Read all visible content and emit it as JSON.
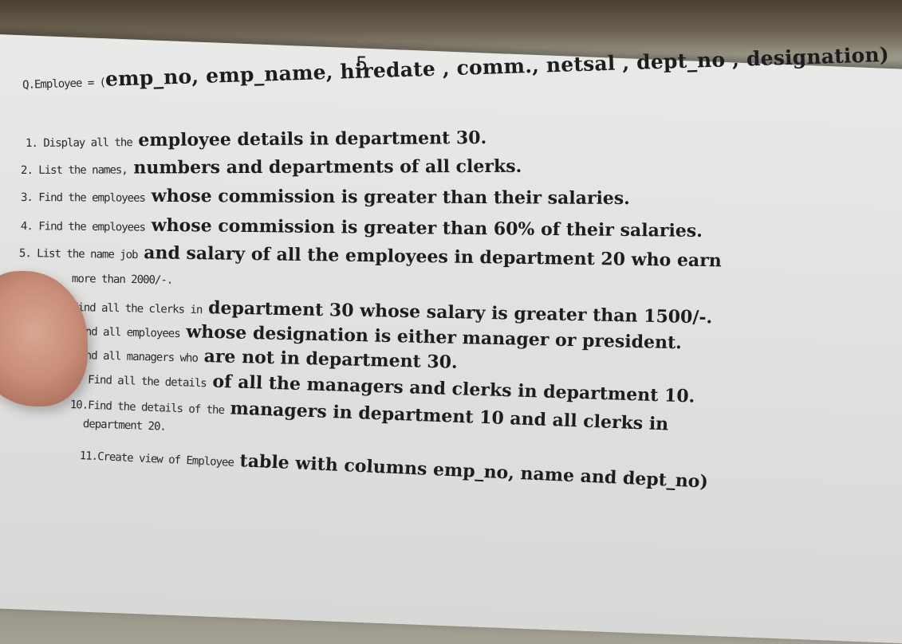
{
  "page_number": "5",
  "header": {
    "prefix": "Q.Employee = (",
    "text": "emp_no, emp_name, hiredate , comm., netsal , dept_no , designation)"
  },
  "questions": [
    {
      "prefix": "1. Display all the",
      "text": "employee details in department 30."
    },
    {
      "prefix": "2. List the names,",
      "text": "numbers and departments of all clerks."
    },
    {
      "prefix": "3. Find the employees",
      "text": "whose commission is greater than their salaries."
    },
    {
      "prefix": "4. Find the employees",
      "text": "whose commission is greater than 60% of their salaries."
    },
    {
      "prefix": "5. List the name job",
      "text": "and salary of all the employees in department 20 who earn"
    },
    {
      "prefix": "more than 2000/-.",
      "text": ""
    },
    {
      "prefix": "Find all the clerks in",
      "text": "department 30 whose salary is greater than 1500/-."
    },
    {
      "prefix": "Find all employees",
      "text": "whose designation is either manager or president."
    },
    {
      "prefix": "Find all managers who",
      "text": "are not in department 30."
    },
    {
      "prefix": "9. Find all the details",
      "text": "of all the managers and clerks in department 10."
    },
    {
      "prefix": "10.Find the details of the",
      "text": "managers in department 10 and all clerks in"
    },
    {
      "prefix": "department 20.",
      "text": ""
    },
    {
      "prefix": "11.Create view of Employee",
      "text": "table with columns emp_no, name and dept_no)"
    }
  ]
}
